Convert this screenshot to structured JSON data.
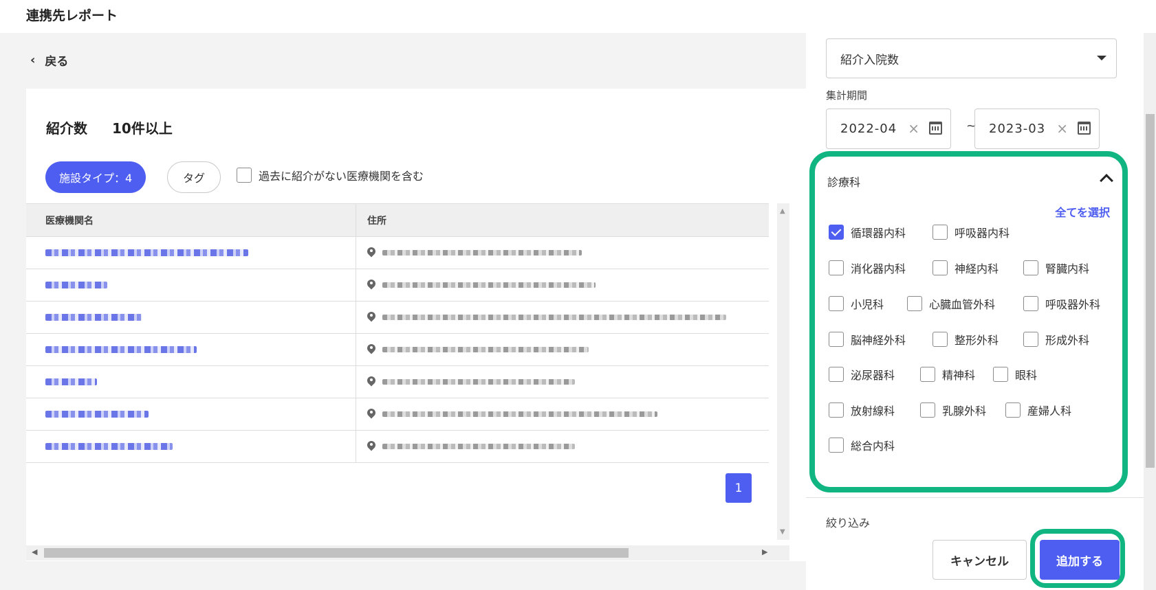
{
  "app": {
    "title": "連携先レポート"
  },
  "nav": {
    "back_label": "戻る"
  },
  "summary": {
    "label": "紹介数",
    "value": "10件以上"
  },
  "filters": {
    "facility_chip": "施設タイプ：4",
    "tag_chip": "タグ",
    "include_label": "過去に紹介がない医療機関を含む"
  },
  "table": {
    "headers": [
      "医療機関名",
      "住所"
    ],
    "rows": [
      {
        "name_width": 295,
        "addr_width": 290
      },
      {
        "name_width": 90,
        "addr_width": 310
      },
      {
        "name_width": 140,
        "addr_width": 500
      },
      {
        "name_width": 220,
        "addr_width": 300
      },
      {
        "name_width": 75,
        "addr_width": 280
      },
      {
        "name_width": 150,
        "addr_width": 400
      },
      {
        "name_width": 185,
        "addr_width": 280
      }
    ]
  },
  "pagination": {
    "current": "1"
  },
  "panel": {
    "metric": "紹介入院数",
    "period_label": "集計期間",
    "date_from": "2022-04",
    "date_to": "2023-03",
    "tilde": "~",
    "dept_title": "診療科",
    "select_all": "全てを選択",
    "departments": [
      {
        "label": "循環器内科",
        "checked": true
      },
      {
        "label": "呼吸器内科",
        "checked": false
      },
      {
        "label": "消化器内科",
        "checked": false
      },
      {
        "label": "神経内科",
        "checked": false
      },
      {
        "label": "腎臓内科",
        "checked": false
      },
      {
        "label": "小児科",
        "checked": false
      },
      {
        "label": "心臓血管外科",
        "checked": false
      },
      {
        "label": "呼吸器外科",
        "checked": false
      },
      {
        "label": "脳神経外科",
        "checked": false
      },
      {
        "label": "整形外科",
        "checked": false
      },
      {
        "label": "形成外科",
        "checked": false
      },
      {
        "label": "泌尿器科",
        "checked": false
      },
      {
        "label": "精神科",
        "checked": false
      },
      {
        "label": "眼科",
        "checked": false
      },
      {
        "label": "放射線科",
        "checked": false
      },
      {
        "label": "乳腺外科",
        "checked": false
      },
      {
        "label": "産婦人科",
        "checked": false
      },
      {
        "label": "総合内科",
        "checked": false
      }
    ],
    "filter_label": "絞り込み",
    "cancel_label": "キャンセル",
    "add_label": "追加する"
  },
  "colors": {
    "accent": "#4e5ef0",
    "highlight": "#10b582"
  }
}
